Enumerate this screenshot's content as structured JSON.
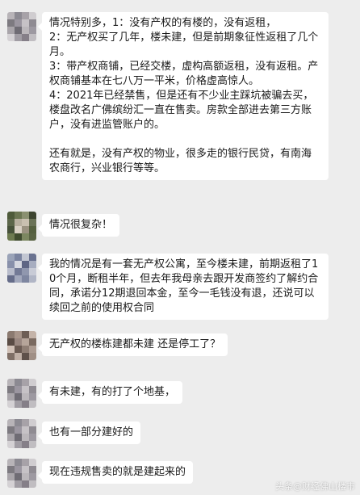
{
  "messages": [
    {
      "paragraphs": [
        "情况特别多，1：没有产权的有楼的，没有返租，",
        "2：无产权买了几年，楼未建，但是前期象征性返租了几个月。",
        "3：带产权商铺，已经交楼，虚构高额返租，没有返租。产权商铺基本在七八万一平米，价格虚高惊人。",
        "4：2021年已经禁售，但是还有不少业主踩坑被骗去买，楼盘改名广佛缤纷汇一直在售卖。房款全部进去第三方账户，没有进监管账户的。",
        "还有就是，没有产权的物业，很多走的银行民贷，有南海农商行，兴业银行等等。"
      ]
    },
    {
      "paragraphs": [
        "情况很复杂！"
      ]
    },
    {
      "paragraphs": [
        "我的情况是有一套无产权公寓，至今楼未建，前期返租了10个月，断租半年，但去年我母亲去跟开发商签约了解约合同，承诺分12期退回本金，至今一毛钱没有退，还说可以续回之前的使用权合同"
      ]
    },
    {
      "paragraphs": [
        "无产权的楼栋建都未建 还是停工了？"
      ]
    },
    {
      "paragraphs": [
        "有未建，有的打了个地基，"
      ]
    },
    {
      "paragraphs": [
        "也有一部分建好的"
      ]
    },
    {
      "paragraphs": [
        "现在违规售卖的就是建起来的"
      ]
    }
  ],
  "colors": {
    "background": "#ededed",
    "bubble": "#ffffff",
    "text": "#1a1a1a"
  },
  "watermark": "头条@财经佛山楼市"
}
